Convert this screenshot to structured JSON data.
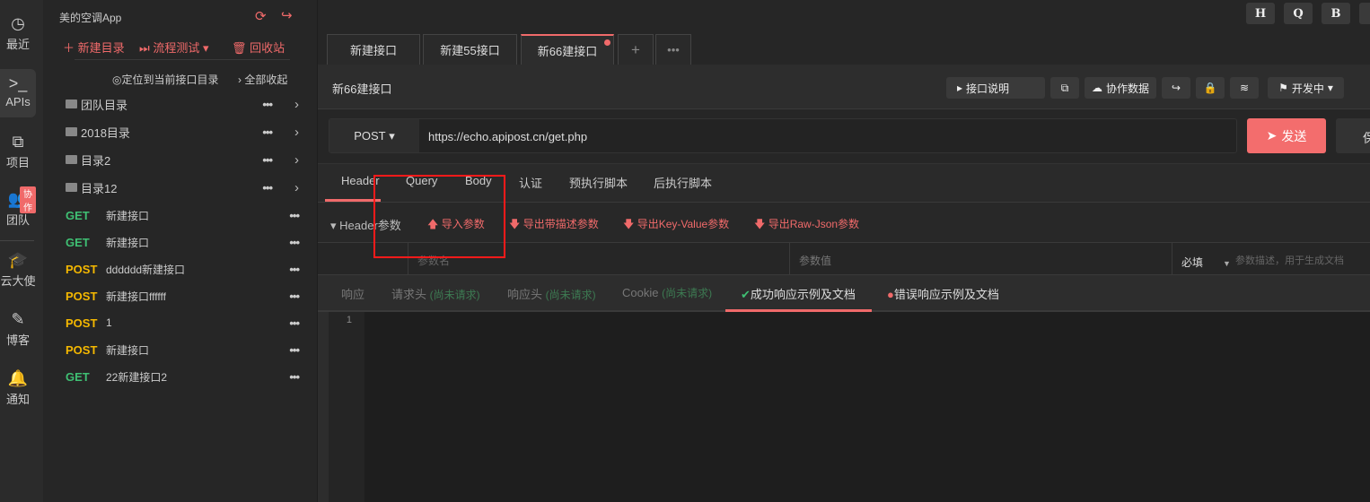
{
  "rail": {
    "items": [
      {
        "label": "最近",
        "icon": "clock-icon"
      },
      {
        "label": "APIs",
        "icon": "terminal-icon"
      },
      {
        "label": "项目",
        "icon": "projects-icon"
      },
      {
        "label": "团队",
        "icon": "team-icon",
        "badge": "协作"
      },
      {
        "label": "云大使",
        "icon": "graduation-cap-icon"
      },
      {
        "label": "博客",
        "icon": "edit-icon"
      },
      {
        "label": "通知",
        "icon": "bell-icon"
      }
    ]
  },
  "sidebar": {
    "project": "美的空调App",
    "new_folder": "新建目录",
    "flow_test": "流程测试",
    "recycle": "回收站",
    "locate": "定位到当前接口目录",
    "collapse_all": "全部收起",
    "folders": [
      "团队目录",
      "2018目录",
      "目录2",
      "目录12"
    ],
    "apis": [
      {
        "method": "GET",
        "name": "新建接口"
      },
      {
        "method": "GET",
        "name": "新建接口"
      },
      {
        "method": "POST",
        "name": "dddddd新建接口"
      },
      {
        "method": "POST",
        "name": "新建接口ffffff"
      },
      {
        "method": "POST",
        "name": "1"
      },
      {
        "method": "POST",
        "name": "新建接口"
      },
      {
        "method": "GET",
        "name": "22新建接口2"
      }
    ]
  },
  "topbar": {
    "buttons": [
      "H",
      "Q",
      "B"
    ]
  },
  "tabs": [
    "新建接口",
    "新建55接口",
    "新66建接口"
  ],
  "header": {
    "title": "新66建接口",
    "doc": "接口说明",
    "collab": "协作数据",
    "status": "开发中"
  },
  "request": {
    "method": "POST",
    "url": "https://echo.apipost.cn/get.php",
    "send": "发送",
    "save": "保"
  },
  "param_tabs": [
    "Header",
    "Query",
    "Body",
    "认证",
    "预执行脚本",
    "后执行脚本"
  ],
  "header_params": {
    "label": "Header参数",
    "import": "导入参数",
    "export_desc": "导出带描述参数",
    "export_kv": "导出Key-Value参数",
    "export_json": "导出Raw-Json参数"
  },
  "table": {
    "name_ph": "参数名",
    "value_ph": "参数值",
    "required": "必填",
    "desc_ph": "参数描述，用于生成文档"
  },
  "response_tabs": {
    "resp": "响应",
    "req_head": "请求头",
    "resp_head": "响应头",
    "cookie": "Cookie",
    "pending": "(尚未请求)",
    "success": "成功响应示例及文档",
    "error": "错误响应示例及文档"
  },
  "editor": {
    "line": "1"
  },
  "colors": {
    "accent": "#f06a6a",
    "get": "#3fbf73",
    "post": "#f5b800"
  }
}
